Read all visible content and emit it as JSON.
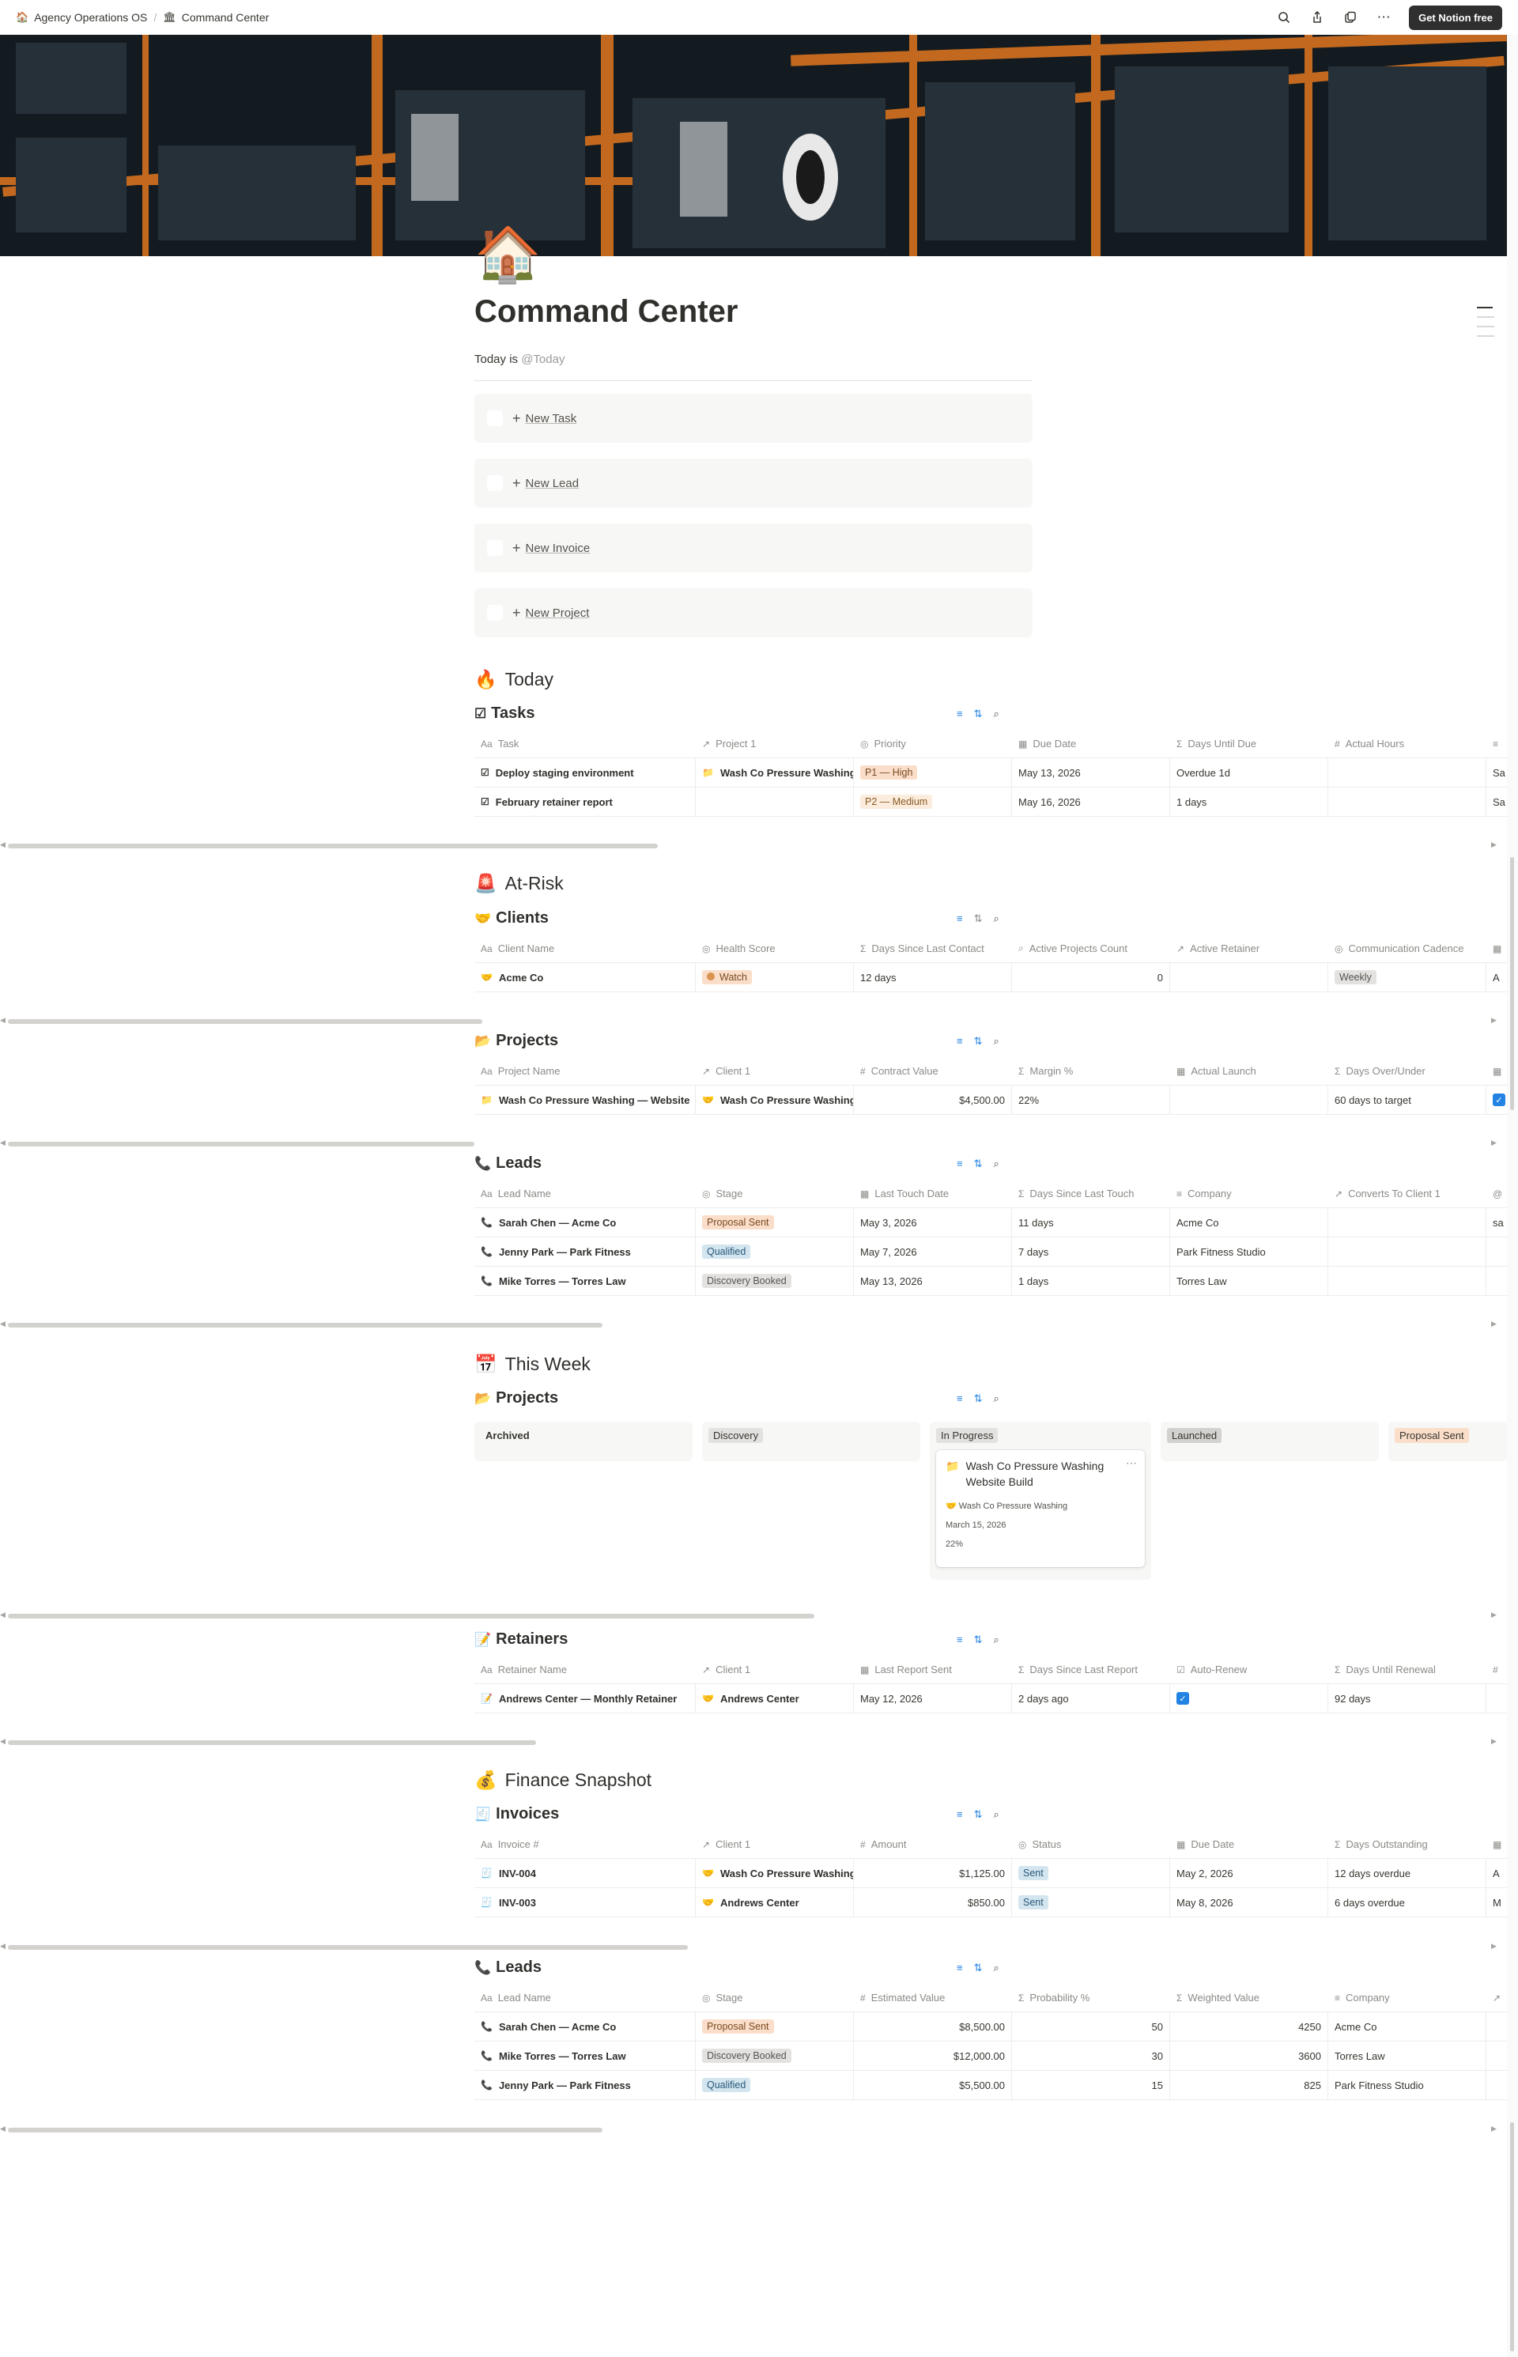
{
  "breadcrumb": {
    "workspace": "Agency Operations OS",
    "page": "Command Center"
  },
  "topbar": {
    "cta": "Get Notion free"
  },
  "page": {
    "title": "Command Center",
    "today_prefix": "Today is ",
    "today_mention": "@Today"
  },
  "buttons": [
    "New Task",
    "New Lead",
    "New Invoice",
    "New Project"
  ],
  "sections": {
    "today": "Today",
    "at_risk": "At-Risk",
    "this_week": "This Week",
    "finance": "Finance Snapshot"
  },
  "tasks": {
    "title": "Tasks",
    "columns": [
      "Task",
      "Project 1",
      "Priority",
      "Due Date",
      "Days Until Due",
      "Actual Hours"
    ],
    "rows": [
      [
        "Deploy staging environment",
        "Wash Co Pressure Washing",
        "P1 — High",
        "May 13, 2026",
        "Overdue 1d",
        "",
        "Sa"
      ],
      [
        "February retainer report",
        "",
        "P2 — Medium",
        "May 16, 2026",
        "1 days",
        "",
        "Sa"
      ]
    ]
  },
  "clients": {
    "title": "Clients",
    "columns": [
      "Client Name",
      "Health Score",
      "Days Since Last Contact",
      "Active Projects Count",
      "Active Retainer",
      "Communication Cadence"
    ],
    "rows": [
      [
        "Acme Co",
        "Watch",
        "12 days",
        "0",
        "",
        "Weekly",
        "A"
      ]
    ]
  },
  "projects_risk": {
    "title": "Projects",
    "columns": [
      "Project Name",
      "Client 1",
      "Contract Value",
      "Margin %",
      "Actual Launch",
      "Days Over/Under"
    ],
    "rows": [
      [
        "Wash Co Pressure Washing — Website",
        "Wash Co Pressure Washing",
        "$4,500.00",
        "22%",
        "",
        "60 days to target"
      ]
    ]
  },
  "leads_risk": {
    "title": "Leads",
    "columns": [
      "Lead Name",
      "Stage",
      "Last Touch Date",
      "Days Since Last Touch",
      "Company",
      "Converts To Client 1"
    ],
    "rows": [
      [
        "Sarah Chen — Acme Co",
        "Proposal Sent",
        "May 3, 2026",
        "11 days",
        "Acme Co",
        "",
        "sa"
      ],
      [
        "Jenny Park — Park Fitness",
        "Qualified",
        "May 7, 2026",
        "7 days",
        "Park Fitness Studio",
        "",
        ""
      ],
      [
        "Mike Torres — Torres Law",
        "Discovery Booked",
        "May 13, 2026",
        "1 days",
        "Torres Law",
        "",
        ""
      ]
    ]
  },
  "projects_week": {
    "title": "Projects",
    "groups": [
      "Archived",
      "Discovery",
      "In Progress",
      "Launched",
      "Proposal Sent"
    ],
    "card": {
      "title": "Wash Co Pressure Washing Website Build",
      "client": "Wash Co Pressure Washing",
      "date": "March 15, 2026",
      "margin": "22%"
    }
  },
  "retainers": {
    "title": "Retainers",
    "columns": [
      "Retainer Name",
      "Client 1",
      "Last Report Sent",
      "Days Since Last Report",
      "Auto-Renew",
      "Days Until Renewal"
    ],
    "rows": [
      [
        "Andrews Center — Monthly Retainer",
        "Andrews Center",
        "May 12, 2026",
        "2 days ago",
        "✓",
        "92 days"
      ]
    ]
  },
  "invoices": {
    "title": "Invoices",
    "columns": [
      "Invoice #",
      "Client 1",
      "Amount",
      "Status",
      "Due Date",
      "Days Outstanding"
    ],
    "rows": [
      [
        "INV-004",
        "Wash Co Pressure Washing",
        "$1,125.00",
        "Sent",
        "May 2, 2026",
        "12 days overdue",
        "A"
      ],
      [
        "INV-003",
        "Andrews Center",
        "$850.00",
        "Sent",
        "May 8, 2026",
        "6 days overdue",
        "M"
      ]
    ]
  },
  "leads_fin": {
    "title": "Leads",
    "columns": [
      "Lead Name",
      "Stage",
      "Estimated Value",
      "Probability %",
      "Weighted Value",
      "Company"
    ],
    "rows": [
      [
        "Sarah Chen — Acme Co",
        "Proposal Sent",
        "$8,500.00",
        "50",
        "4250",
        "Acme Co"
      ],
      [
        "Mike Torres — Torres Law",
        "Discovery Booked",
        "$12,000.00",
        "30",
        "3600",
        "Torres Law"
      ],
      [
        "Jenny Park — Park Fitness",
        "Qualified",
        "$5,500.00",
        "15",
        "825",
        "Park Fitness Studio"
      ]
    ]
  },
  "colors": {
    "accent": "#2383e2",
    "orange_pill": "#fadec9",
    "blue_pill": "#d3e5ef",
    "gray_pill": "#e3e2e0"
  }
}
